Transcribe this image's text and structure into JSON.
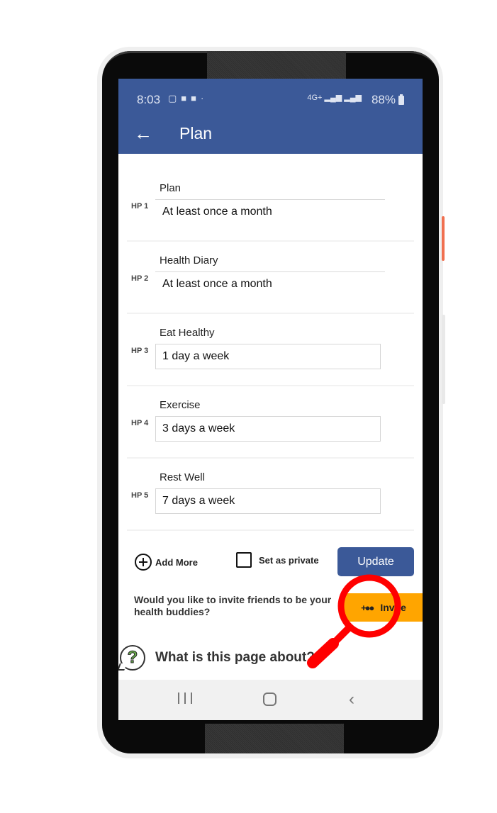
{
  "status_bar": {
    "time": "8:03",
    "notification_icons": [
      "laptop-icon",
      "gamepad-icon",
      "gamepad-icon",
      "dot-icon"
    ],
    "network": "4G+",
    "battery": "88%"
  },
  "header": {
    "title": "Plan",
    "back_icon": "arrow-left-icon"
  },
  "plans": [
    {
      "hp": "HP 1",
      "name": "Plan",
      "value": "At least once a month",
      "field_style": "underline"
    },
    {
      "hp": "HP 2",
      "name": "Health Diary",
      "value": "At least once a month",
      "field_style": "underline"
    },
    {
      "hp": "HP 3",
      "name": "Eat Healthy",
      "value": "1 day a week",
      "field_style": "box"
    },
    {
      "hp": "HP 4",
      "name": "Exercise",
      "value": "3 days a week",
      "field_style": "box"
    },
    {
      "hp": "HP 5",
      "name": "Rest Well",
      "value": "7 days a week",
      "field_style": "box"
    }
  ],
  "actions": {
    "add_more_label": "Add More",
    "private_label": "Set as private",
    "private_checked": false,
    "update_label": "Update"
  },
  "invite": {
    "prompt": "Would you like to invite friends to be your health buddies?",
    "button_label": "Invite"
  },
  "about": {
    "label": "What is this page about?"
  },
  "colors": {
    "primary": "#3b5998",
    "invite": "#ffa500",
    "highlight": "#ff0000"
  }
}
